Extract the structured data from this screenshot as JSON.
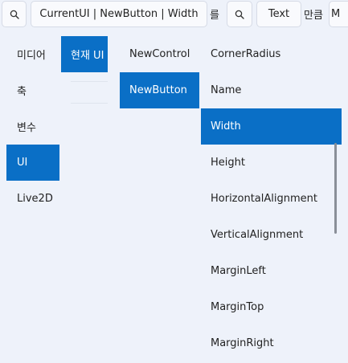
{
  "topbar": {
    "path_value": "CurrentUI | NewButton | Width",
    "suffix1": "를",
    "text_value": "Text",
    "suffix2": "만큼",
    "cut_label": "M"
  },
  "columns": {
    "categories": [
      "미디어",
      "축",
      "변수",
      "UI",
      "Live2D"
    ],
    "scopes": [
      "현재 UI"
    ],
    "controls": [
      "NewControl",
      "NewButton"
    ],
    "properties": [
      "CornerRadius",
      "Name",
      "Width",
      "Height",
      "HorizontalAlignment",
      "VerticalAlignment",
      "MarginLeft",
      "MarginTop",
      "MarginRight"
    ]
  },
  "colors": {
    "accent": "#0a6fc6",
    "background": "#eef2fa"
  },
  "icons": {
    "search": "magnifier"
  }
}
